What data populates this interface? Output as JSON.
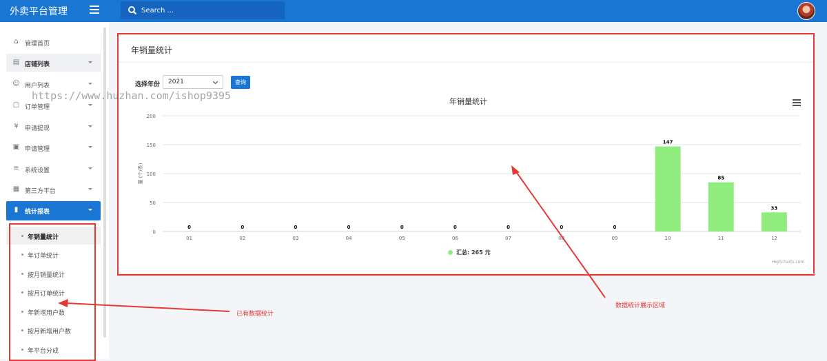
{
  "app": {
    "brand": "外卖平台管理"
  },
  "search": {
    "placeholder": "Search ..."
  },
  "sidebar": {
    "items": [
      {
        "label": "管理首页",
        "icon": "home-icon"
      },
      {
        "label": "店铺列表",
        "icon": "store-icon"
      },
      {
        "label": "用户列表",
        "icon": "users-icon"
      },
      {
        "label": "订单管理",
        "icon": "clipboard-icon"
      },
      {
        "label": "申请提现",
        "icon": "yen-icon"
      },
      {
        "label": "申请管理",
        "icon": "clipboard-check-icon"
      },
      {
        "label": "系统设置",
        "icon": "sliders-icon"
      },
      {
        "label": "第三方平台",
        "icon": "grid-icon"
      },
      {
        "label": "统计报表",
        "icon": "bar-chart-icon"
      }
    ],
    "sub_items": [
      "年销量统计",
      "年订单统计",
      "按月销量统计",
      "按月订单统计",
      "年新增用户数",
      "按月新增用户数",
      "年平台分成"
    ]
  },
  "panel": {
    "title": "年销量统计",
    "year_label": "选择年份",
    "year_value": "2021",
    "query_button": "查询"
  },
  "chart_data": {
    "type": "bar",
    "title": "年销量统计",
    "ylabel": "量 (个/条)",
    "categories": [
      "01",
      "02",
      "03",
      "04",
      "05",
      "06",
      "07",
      "08",
      "09",
      "10",
      "11",
      "12"
    ],
    "values": [
      0,
      0,
      0,
      0,
      0,
      0,
      0,
      0,
      0,
      147,
      85,
      33
    ],
    "ylim": [
      0,
      200
    ],
    "yticks": [
      0,
      50,
      100,
      150,
      200
    ],
    "legend": "汇总: 265 元",
    "color": "#90ed7d",
    "credits": "Highcharts.com"
  },
  "annotations": {
    "watermark": "https://www.huzhan.com/ishop9395",
    "existing_stats": "已有数据统计",
    "display_area": "数据统计展示区域",
    "color": "#e53935"
  }
}
